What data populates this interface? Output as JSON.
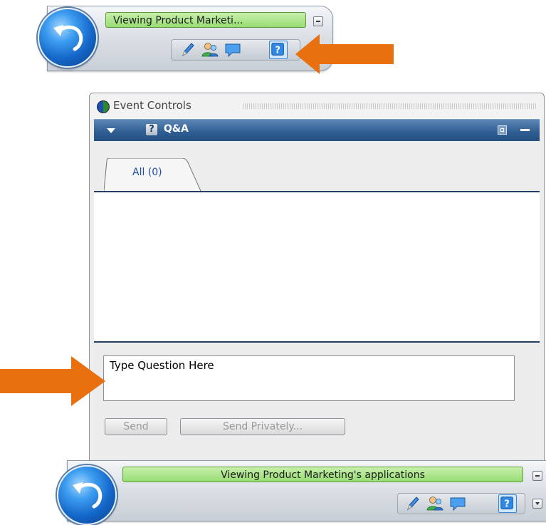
{
  "top_toolbar": {
    "status_text": "Viewing Product Marketi...",
    "back_icon": "back-arrow-icon",
    "icons": [
      "pencil-icon",
      "attendees-icon",
      "chat-icon",
      "qa-icon"
    ],
    "selected_icon": "qa-icon"
  },
  "panel": {
    "title": "Event Controls",
    "section_title": "Q&A",
    "section_icon_glyph": "?",
    "tabs": [
      {
        "label": "All (0)"
      }
    ],
    "question_input": {
      "value": "Type Question Here"
    },
    "buttons": {
      "send": "Send",
      "send_privately": "Send Privately..."
    }
  },
  "bottom_toolbar": {
    "status_text": "Viewing Product Marketing's applications",
    "back_icon": "back-arrow-icon",
    "icons": [
      "pencil-icon",
      "attendees-icon",
      "chat-icon",
      "qa-icon"
    ],
    "selected_icon": "qa-icon"
  },
  "colors": {
    "status_green": "#98dc74",
    "header_blue": "#2e5d93",
    "arrow_orange": "#e8700f",
    "accent_blue": "#1466c8"
  }
}
